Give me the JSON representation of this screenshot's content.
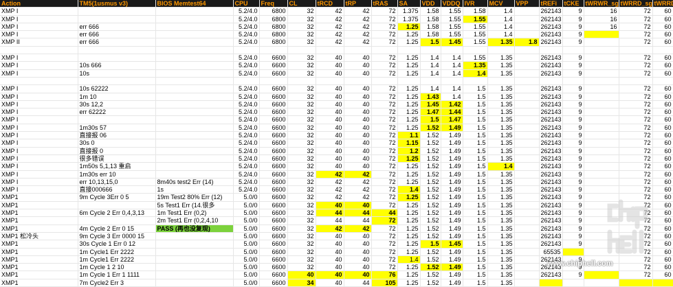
{
  "columns": [
    "Action",
    "TM5(1usmus v3)",
    "BIOS Memtest64",
    "CPU",
    "Freq",
    "CL",
    "tRCD",
    "tRP",
    "tRAS",
    "SA",
    "VDD",
    "VDDQ",
    "IVR",
    "MCV",
    "VPP",
    "tREFi",
    "tCKE",
    "tWRWR_sg",
    "tWRRD_sg",
    "tWRRD_dg"
  ],
  "rows": [
    {
      "c": [
        "XMP I",
        "",
        "",
        "5.2/4.0",
        "6800",
        "32",
        "42",
        "42",
        "72",
        "1.375",
        "1.58",
        "1.55",
        "1.58",
        "1.4",
        "",
        "262143",
        "9",
        "16",
        "72",
        "60"
      ]
    },
    {
      "c": [
        "XMP I",
        "",
        "",
        "5.2/4.0",
        "6800",
        "32",
        "42",
        "42",
        "72",
        "1.375",
        "1.58",
        "1.55",
        "1.55",
        "1.4",
        "",
        "262143",
        "9",
        "16",
        "72",
        "60"
      ],
      "y": [
        12
      ],
      "b": [
        12
      ]
    },
    {
      "c": [
        "XMP I",
        "err  666",
        "",
        "5.2/4.0",
        "6800",
        "32",
        "42",
        "42",
        "72",
        "1.25",
        "1.58",
        "1.55",
        "1.55",
        "1.4",
        "",
        "262143",
        "9",
        "16",
        "72",
        "60"
      ],
      "y": [
        9
      ],
      "b": [
        9
      ]
    },
    {
      "c": [
        "XMP I",
        "err  666",
        "",
        "5.2/4.0",
        "6800",
        "32",
        "42",
        "42",
        "72",
        "1.25",
        "1.58",
        "1.55",
        "1.55",
        "1.4",
        "",
        "262143",
        "9",
        "",
        "72",
        "60"
      ],
      "y": [
        17
      ]
    },
    {
      "c": [
        "XMP II",
        "err 666",
        "",
        "5.2/4.0",
        "6800",
        "32",
        "42",
        "42",
        "72",
        "1.25",
        "1.5",
        "1.45",
        "1.55",
        "1.35",
        "1.8",
        "262143",
        "9",
        "",
        "72",
        "60"
      ],
      "y": [
        10,
        11,
        13,
        14
      ],
      "b": [
        10,
        11,
        13,
        14
      ]
    },
    {
      "c": [
        "",
        "",
        "",
        "",
        "",
        "",
        "",
        "",
        "",
        "",
        "",
        "",
        "",
        "",
        "",
        "",
        "",
        "",
        "",
        ""
      ]
    },
    {
      "c": [
        "XMP I",
        "",
        "",
        "5.2/4.0",
        "6600",
        "32",
        "40",
        "40",
        "72",
        "1.25",
        "1.4",
        "1.4",
        "1.55",
        "1.35",
        "",
        "262143",
        "9",
        "",
        "72",
        "60"
      ]
    },
    {
      "c": [
        "XMP I",
        "10s  666",
        "",
        "5.2/4.0",
        "6600",
        "32",
        "40",
        "40",
        "72",
        "1.25",
        "1.4",
        "1.4",
        "1.35",
        "1.35",
        "",
        "262143",
        "9",
        "",
        "72",
        "60"
      ],
      "y": [
        12
      ],
      "b": [
        12
      ]
    },
    {
      "c": [
        "XMP I",
        "10s",
        "",
        "5.2/4.0",
        "6600",
        "32",
        "40",
        "40",
        "72",
        "1.25",
        "1.4",
        "1.4",
        "1.4",
        "1.35",
        "",
        "262143",
        "9",
        "",
        "72",
        "60"
      ],
      "y": [
        12
      ],
      "b": [
        12
      ]
    },
    {
      "c": [
        "",
        "",
        "",
        "",
        "",
        "",
        "",
        "",
        "",
        "",
        "",
        "",
        "",
        "",
        "",
        "",
        "",
        "",
        "",
        ""
      ]
    },
    {
      "c": [
        "XMP I",
        "10s  62222",
        "",
        "5.2/4.0",
        "6600",
        "32",
        "40",
        "40",
        "72",
        "1.25",
        "1.4",
        "1.4",
        "1.5",
        "1.35",
        "",
        "262143",
        "9",
        "",
        "72",
        "60"
      ]
    },
    {
      "c": [
        "XMP I",
        "1m  10",
        "",
        "5.2/4.0",
        "6600",
        "32",
        "40",
        "40",
        "72",
        "1.25",
        "1.43",
        "1.4",
        "1.5",
        "1.35",
        "",
        "262143",
        "9",
        "",
        "72",
        "60"
      ],
      "y": [
        10
      ],
      "b": [
        10
      ]
    },
    {
      "c": [
        "XMP I",
        "30s 12,2",
        "",
        "5.2/4.0",
        "6600",
        "32",
        "40",
        "40",
        "72",
        "1.25",
        "1.45",
        "1.42",
        "1.5",
        "1.35",
        "",
        "262143",
        "9",
        "",
        "72",
        "60"
      ],
      "y": [
        10,
        11
      ],
      "b": [
        10,
        11
      ]
    },
    {
      "c": [
        "XMP I",
        "err 62222",
        "",
        "5.2/4.0",
        "6600",
        "32",
        "40",
        "40",
        "72",
        "1.25",
        "1.47",
        "1.44",
        "1.5",
        "1.35",
        "",
        "262143",
        "9",
        "",
        "72",
        "60"
      ],
      "y": [
        10,
        11
      ],
      "b": [
        10,
        11
      ]
    },
    {
      "c": [
        "XMP I",
        "",
        "",
        "5.2/4.0",
        "6600",
        "32",
        "40",
        "40",
        "72",
        "1.25",
        "1.5",
        "1.47",
        "1.5",
        "1.35",
        "",
        "262143",
        "9",
        "",
        "72",
        "60"
      ],
      "y": [
        10,
        11
      ],
      "b": [
        10,
        11
      ]
    },
    {
      "c": [
        "XMP I",
        "1m30s  57",
        "",
        "5.2/4.0",
        "6600",
        "32",
        "40",
        "40",
        "72",
        "1.25",
        "1.52",
        "1.49",
        "1.5",
        "1.35",
        "",
        "262143",
        "9",
        "",
        "72",
        "60"
      ],
      "y": [
        10,
        11
      ],
      "b": [
        10,
        11
      ]
    },
    {
      "c": [
        "XMP I",
        "直接报 06",
        "",
        "5.2/4.0",
        "6600",
        "32",
        "40",
        "40",
        "72",
        "1.1",
        "1.52",
        "1.49",
        "1.5",
        "1.35",
        "",
        "262143",
        "9",
        "",
        "72",
        "60"
      ],
      "y": [
        9
      ],
      "b": [
        9
      ]
    },
    {
      "c": [
        "XMP I",
        "30s 0",
        "",
        "5.2/4.0",
        "6600",
        "32",
        "40",
        "40",
        "72",
        "1.15",
        "1.52",
        "1.49",
        "1.5",
        "1.35",
        "",
        "262143",
        "9",
        "",
        "72",
        "60"
      ],
      "y": [
        9
      ],
      "b": [
        9
      ]
    },
    {
      "c": [
        "XMP I",
        "直接报 0",
        "",
        "5.2/4.0",
        "6600",
        "32",
        "40",
        "40",
        "72",
        "1.2",
        "1.52",
        "1.49",
        "1.5",
        "1.35",
        "",
        "262143",
        "9",
        "",
        "72",
        "60"
      ],
      "y": [
        9
      ],
      "b": [
        9
      ]
    },
    {
      "c": [
        "XMP I",
        "很多错误",
        "",
        "5.2/4.0",
        "6600",
        "32",
        "40",
        "40",
        "72",
        "1.25",
        "1.52",
        "1.49",
        "1.5",
        "1.35",
        "",
        "262143",
        "9",
        "",
        "72",
        "60"
      ],
      "y": [
        9
      ],
      "b": [
        9
      ]
    },
    {
      "c": [
        "XMP I",
        "1m50s  5,1,13 重启",
        "",
        "5.2/4.0",
        "6600",
        "32",
        "40",
        "40",
        "72",
        "1.25",
        "1.52",
        "1.49",
        "1.5",
        "1.4",
        "",
        "262143",
        "9",
        "",
        "72",
        "60"
      ],
      "y": [
        13
      ],
      "b": [
        13
      ]
    },
    {
      "c": [
        "XMP I",
        "1m30s  err 10",
        "",
        "5.2/4.0",
        "6600",
        "32",
        "42",
        "42",
        "72",
        "1.25",
        "1.52",
        "1.49",
        "1.5",
        "1.35",
        "",
        "262143",
        "9",
        "",
        "72",
        "60"
      ],
      "y": [
        6,
        7
      ],
      "b": [
        6,
        7
      ]
    },
    {
      "c": [
        "XMP I",
        "err  10,13,15,0",
        "8m40s test2 Err  (14)",
        "5.2/4.0",
        "6600",
        "32",
        "42",
        "42",
        "72",
        "1.25",
        "1.52",
        "1.49",
        "1.5",
        "1.35",
        "",
        "262143",
        "9",
        "",
        "72",
        "60"
      ]
    },
    {
      "c": [
        "XMP I",
        "直接000666",
        "1s",
        "5.2/4.0",
        "6600",
        "32",
        "42",
        "42",
        "72",
        "1.4",
        "1.52",
        "1.49",
        "1.5",
        "1.35",
        "",
        "262143",
        "9",
        "",
        "72",
        "60"
      ],
      "y": [
        9
      ],
      "b": [
        9
      ]
    },
    {
      "c": [
        "XMP1",
        "9m Cycle 3Err 0 5",
        "19m  Test2 80% Err (12)",
        "5.0/0",
        "6600",
        "32",
        "42",
        "42",
        "72",
        "1.25",
        "1.52",
        "1.49",
        "1.5",
        "1.35",
        "",
        "262143",
        "9",
        "",
        "72",
        "60"
      ],
      "y": [
        9
      ],
      "b": [
        9
      ]
    },
    {
      "c": [
        "XMP1",
        "",
        "5s   Test1 Err (14.很多",
        "5.0/0",
        "6600",
        "32",
        "40",
        "40",
        "72",
        "1.25",
        "1.52",
        "1.49",
        "1.5",
        "1.35",
        "",
        "262143",
        "9",
        "",
        "72",
        "60"
      ],
      "y": [
        6,
        7
      ],
      "b": [
        6,
        7
      ]
    },
    {
      "c": [
        "XMP1",
        "6m Cycle 2 Err 0,4,3,13",
        "1m Test1 Err (0,2)",
        "5.0/0",
        "6600",
        "32",
        "44",
        "44",
        "44",
        "1.25",
        "1.52",
        "1.49",
        "1.5",
        "1.35",
        "",
        "262143",
        "9",
        "",
        "72",
        "60"
      ],
      "y": [
        6,
        7,
        8
      ],
      "b": [
        6,
        7,
        8
      ]
    },
    {
      "c": [
        "XMP1",
        "",
        "2m Test1 Err (0,2,4,10",
        "5.0/0",
        "6600",
        "32",
        "44",
        "44",
        "72",
        "1.25",
        "1.52",
        "1.49",
        "1.5",
        "1.35",
        "",
        "262143",
        "9",
        "",
        "72",
        "60"
      ],
      "y": [
        8
      ],
      "b": [
        8
      ]
    },
    {
      "c": [
        "XMP1",
        "4m Cycle 2 Err 0 15",
        "PASS  (再也没复现)",
        "5.0/0",
        "6600",
        "32",
        "42",
        "42",
        "72",
        "1.25",
        "1.52",
        "1.49",
        "1.5",
        "1.35",
        "",
        "262143",
        "9",
        "",
        "72",
        "60"
      ],
      "y": [
        6,
        7
      ],
      "b": [
        2,
        6,
        7
      ],
      "g": [
        2
      ]
    },
    {
      "c": [
        "XMP1   松冷头",
        "9m Cycle 3 Err 0000  15",
        "",
        "5.0/0",
        "6600",
        "32",
        "40",
        "40",
        "72",
        "1.25",
        "1.52",
        "1.49",
        "1.5",
        "1.35",
        "",
        "262143",
        "9",
        "",
        "72",
        "60"
      ]
    },
    {
      "c": [
        "XMP1",
        "30s Cycle 1 Err  0 12",
        "",
        "5.0/0",
        "6600",
        "32",
        "40",
        "40",
        "72",
        "1.25",
        "1.5",
        "1.45",
        "1.5",
        "1.35",
        "",
        "262143",
        "9",
        "",
        "72",
        "60"
      ],
      "y": [
        10,
        11
      ],
      "b": [
        10,
        11
      ]
    },
    {
      "c": [
        "XMP1",
        "1m Cycle1 Err 2222",
        "",
        "5.0/0",
        "6600",
        "32",
        "40",
        "40",
        "72",
        "1.25",
        "1.52",
        "1.49",
        "1.5",
        "1.35",
        "",
        "65535",
        "",
        "",
        "72",
        "60"
      ],
      "y": [
        16
      ]
    },
    {
      "c": [
        "XMP1",
        "1m Cycle1 Err 2222",
        "",
        "5.0/0",
        "6600",
        "32",
        "40",
        "40",
        "72",
        "1.4",
        "1.52",
        "1.49",
        "1.5",
        "1.35",
        "",
        "262143",
        "9",
        "",
        "72",
        "60"
      ],
      "y": [
        9
      ]
    },
    {
      "c": [
        "XMP1",
        "1m Cycle 1 2 10",
        "",
        "5.0/0",
        "6600",
        "32",
        "40",
        "40",
        "72",
        "1.25",
        "1.52",
        "1.49",
        "1.5",
        "1.35",
        "",
        "262143",
        "9",
        "",
        "72",
        "60"
      ],
      "y": [
        10,
        11
      ],
      "b": [
        10,
        11
      ]
    },
    {
      "c": [
        "XMP1",
        "1m Cycle 1 Err 1 1111",
        "",
        "5.0/0",
        "6600",
        "40",
        "40",
        "40",
        "76",
        "1.25",
        "1.52",
        "1.49",
        "1.5",
        "1.35",
        "",
        "262143",
        "9",
        "",
        "72",
        "60"
      ],
      "y": [
        5,
        6,
        7,
        8,
        17
      ],
      "b": [
        5,
        6,
        7,
        8
      ]
    },
    {
      "c": [
        "XMP1",
        "7m Cycle2  Err  3",
        "",
        "5.0/0",
        "6600",
        "34",
        "40",
        "44",
        "105",
        "1.25",
        "1.52",
        "1.49",
        "1.5",
        "1.35",
        "",
        "",
        "",
        "",
        "",
        ""
      ],
      "y": [
        5,
        8,
        15,
        18,
        19
      ],
      "b": [
        5,
        8
      ]
    }
  ],
  "watermark": {
    "url": "www.chiphell.com"
  },
  "colors": {
    "header_bg": "#1a1a1a",
    "header_fg": "#ff9800",
    "highlight": "#ffff00",
    "pass": "#7cd23c"
  }
}
